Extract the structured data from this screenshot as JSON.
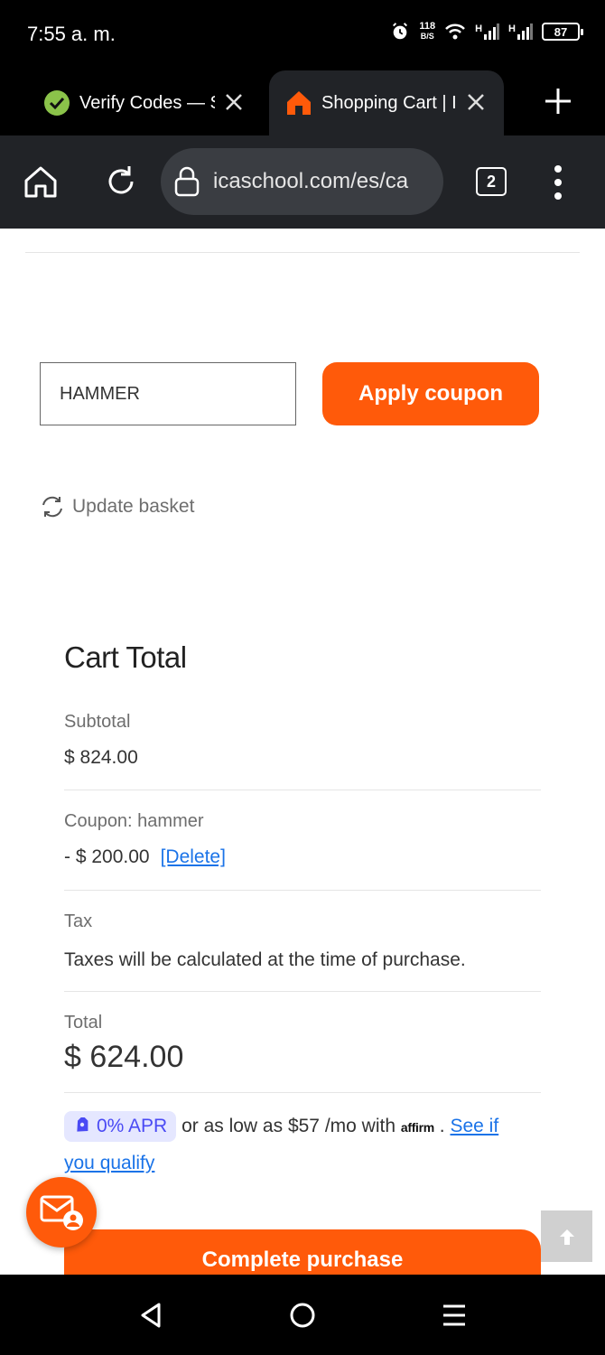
{
  "status_bar": {
    "time": "7:55 a. m.",
    "net_speed_value": "118",
    "net_speed_unit": "B/S",
    "signal_1": "H",
    "signal_2": "H",
    "battery": "87"
  },
  "browser": {
    "tabs": [
      {
        "title": "Verify Codes — S",
        "icon": "verify-codes-favicon-icon"
      },
      {
        "title": "Shopping Cart | I",
        "icon": "home-favicon-icon",
        "active": true
      }
    ],
    "url": "icaschool.com/es/ca",
    "tab_count": "2"
  },
  "coupon": {
    "input_value": "HAMMER",
    "apply_label": "Apply coupon"
  },
  "update_basket_label": "Update basket",
  "cart_total": {
    "title": "Cart Total",
    "subtotal_label": "Subtotal",
    "subtotal_value": "$ 824.00",
    "coupon_label": "Coupon: hammer",
    "coupon_value": "- $ 200.00",
    "delete_label": "[Delete]",
    "tax_label": "Tax",
    "tax_value": "Taxes will be calculated at the time of purchase.",
    "total_label": "Total",
    "total_value": "$ 624.00"
  },
  "affirm": {
    "apr_badge": "0% APR",
    "text": "or as low as $57 /mo with",
    "logo": "affirm",
    "period": ".",
    "link": "See if you qualify"
  },
  "complete_purchase_label": "Complete purchase",
  "colors": {
    "accent": "#ff5a0a",
    "link": "#1a73e8",
    "toolbar": "#212327"
  }
}
